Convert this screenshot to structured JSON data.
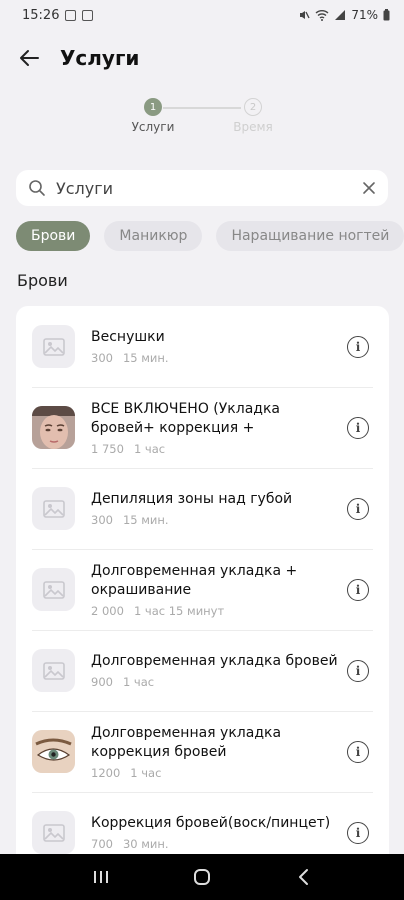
{
  "status_bar": {
    "time": "15:26",
    "battery": "71%"
  },
  "header": {
    "title": "Услуги"
  },
  "stepper": {
    "steps": [
      {
        "number": "1",
        "label": "Услуги"
      },
      {
        "number": "2",
        "label": "Время"
      }
    ]
  },
  "search": {
    "value": "Услуги",
    "placeholder": "Услуги"
  },
  "categories": [
    "Брови",
    "Маникюр",
    "Наращивание ногтей"
  ],
  "section_title": "Брови",
  "services": [
    {
      "name": "Веснушки",
      "price": "300",
      "duration": "15 мин.",
      "thumb": "image-placeholder-icon"
    },
    {
      "name": "ВСЕ ВКЛЮЧЕНО (Укладка бровей+ коррекция +",
      "price": "1 750",
      "duration": "1 час",
      "thumb": "face-photo"
    },
    {
      "name": "Депиляция зоны над губой",
      "price": "300",
      "duration": "15 мин.",
      "thumb": "image-placeholder-icon"
    },
    {
      "name": "Долговременная укладка + окрашивание",
      "price": "2 000",
      "duration": "1 час 15 минут",
      "thumb": "image-placeholder-icon"
    },
    {
      "name": "Долговременная укладка бровей",
      "price": "900",
      "duration": "1 час",
      "thumb": "image-placeholder-icon"
    },
    {
      "name": "Долговременная укладка коррекция бровей",
      "price": "1200",
      "duration": "1 час",
      "thumb": "eye-photo"
    },
    {
      "name": "Коррекция бровей(воск/пинцет)",
      "price": "700",
      "duration": "30 мин.",
      "thumb": "image-placeholder-icon"
    }
  ],
  "colors": {
    "accent": "#7d8b74",
    "background": "#f2f1f4"
  }
}
